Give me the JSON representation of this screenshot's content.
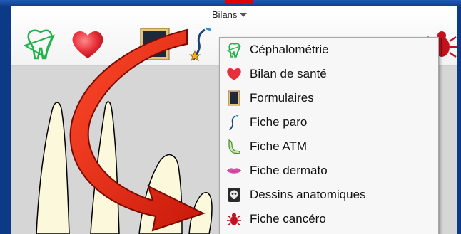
{
  "toolbar": {
    "menu_label": "Bilans",
    "icons": [
      "tooth-cephalometry-icon",
      "heart-icon",
      "form-icon",
      "perio-probe-icon",
      "tmj-icon",
      "lips-icon",
      "skull-icon",
      "bug-icon"
    ]
  },
  "bilans_menu": {
    "items": [
      {
        "label": "Céphalométrie",
        "icon": "tooth-cephalometry-icon"
      },
      {
        "label": "Bilan de santé",
        "icon": "heart-icon"
      },
      {
        "label": "Formulaires",
        "icon": "form-icon"
      },
      {
        "label": "Fiche paro",
        "icon": "perio-probe-icon"
      },
      {
        "label": "Fiche ATM",
        "icon": "tmj-icon"
      },
      {
        "label": "Fiche dermato",
        "icon": "lips-icon"
      },
      {
        "label": "Dessins anatomiques",
        "icon": "skull-icon"
      },
      {
        "label": "Fiche cancéro",
        "icon": "bug-icon"
      }
    ]
  },
  "colors": {
    "background": "#0b3a87",
    "arrow_red": "#e12410",
    "heart_red": "#e8303a",
    "tooth_green": "#21b34a",
    "tooth_fill": "#fcf8dc"
  }
}
